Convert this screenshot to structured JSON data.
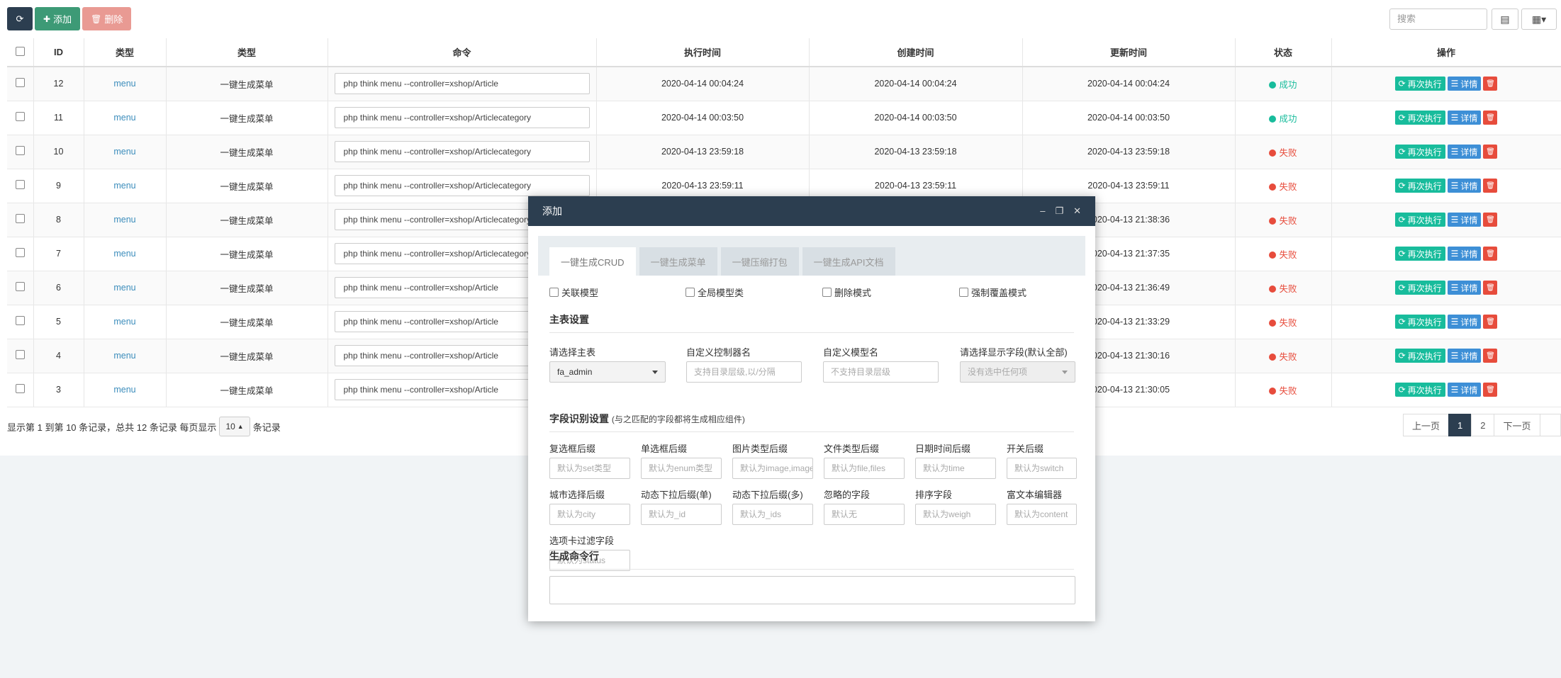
{
  "toolbar": {
    "refresh_icon": "refresh-icon",
    "add_label": "添加",
    "delete_label": "删除",
    "search_placeholder": "搜索"
  },
  "table": {
    "headers": [
      "ID",
      "类型",
      "类型",
      "命令",
      "执行时间",
      "创建时间",
      "更新时间",
      "状态",
      "操作"
    ],
    "rows": [
      {
        "id": "12",
        "type": "menu",
        "type2": "一键生成菜单",
        "cmd": "php think menu --controller=xshop/Article",
        "exec": "2020-04-14 00:04:24",
        "created": "2020-04-14 00:04:24",
        "updated": "2020-04-14 00:04:24",
        "status": "成功"
      },
      {
        "id": "11",
        "type": "menu",
        "type2": "一键生成菜单",
        "cmd": "php think menu --controller=xshop/Articlecategory",
        "exec": "2020-04-14 00:03:50",
        "created": "2020-04-14 00:03:50",
        "updated": "2020-04-14 00:03:50",
        "status": "成功"
      },
      {
        "id": "10",
        "type": "menu",
        "type2": "一键生成菜单",
        "cmd": "php think menu --controller=xshop/Articlecategory",
        "exec": "2020-04-13 23:59:18",
        "created": "2020-04-13 23:59:18",
        "updated": "2020-04-13 23:59:18",
        "status": "失败"
      },
      {
        "id": "9",
        "type": "menu",
        "type2": "一键生成菜单",
        "cmd": "php think menu --controller=xshop/Articlecategory",
        "exec": "2020-04-13 23:59:11",
        "created": "2020-04-13 23:59:11",
        "updated": "2020-04-13 23:59:11",
        "status": "失败"
      },
      {
        "id": "8",
        "type": "menu",
        "type2": "一键生成菜单",
        "cmd": "php think menu --controller=xshop/Articlecategory",
        "exec": "",
        "created": "",
        "updated": "2020-04-13 21:38:36",
        "status": "失败"
      },
      {
        "id": "7",
        "type": "menu",
        "type2": "一键生成菜单",
        "cmd": "php think menu --controller=xshop/Articlecategory",
        "exec": "",
        "created": "",
        "updated": "2020-04-13 21:37:35",
        "status": "失败"
      },
      {
        "id": "6",
        "type": "menu",
        "type2": "一键生成菜单",
        "cmd": "php think menu --controller=xshop/Article",
        "exec": "",
        "created": "",
        "updated": "2020-04-13 21:36:49",
        "status": "失败"
      },
      {
        "id": "5",
        "type": "menu",
        "type2": "一键生成菜单",
        "cmd": "php think menu --controller=xshop/Article",
        "exec": "",
        "created": "",
        "updated": "2020-04-13 21:33:29",
        "status": "失败"
      },
      {
        "id": "4",
        "type": "menu",
        "type2": "一键生成菜单",
        "cmd": "php think menu --controller=xshop/Article",
        "exec": "",
        "created": "",
        "updated": "2020-04-13 21:30:16",
        "status": "失败"
      },
      {
        "id": "3",
        "type": "menu",
        "type2": "一键生成菜单",
        "cmd": "php think menu --controller=xshop/Article",
        "exec": "",
        "created": "",
        "updated": "2020-04-13 21:30:05",
        "status": "失败"
      }
    ],
    "actions": {
      "rerun": "再次执行",
      "detail": "详情"
    }
  },
  "colors": {
    "success": "#18bc9c",
    "fail": "#e74c3c",
    "dark": "#2c3e50"
  },
  "footer": {
    "info_prefix": "显示第 1 到第 10 条记录，总共 12 条记录 每页显示",
    "page_size": "10",
    "info_suffix": "条记录",
    "prev": "上一页",
    "pages": [
      "1",
      "2"
    ],
    "next": "下一页"
  },
  "modal": {
    "title": "添加",
    "tabs": [
      "一键生成CRUD",
      "一键生成菜单",
      "一键压缩打包",
      "一键生成API文档"
    ],
    "checkboxes": [
      "关联模型",
      "全局模型类",
      "删除模式",
      "强制覆盖模式"
    ],
    "main_section": "主表设置",
    "main_fields": {
      "table_label": "请选择主表",
      "table_value": "fa_admin",
      "controller_label": "自定义控制器名",
      "controller_placeholder": "支持目录层级,以/分隔",
      "model_label": "自定义模型名",
      "model_placeholder": "不支持目录层级",
      "fields_label": "请选择显示字段(默认全部)",
      "fields_placeholder": "没有选中任何项"
    },
    "field_section": "字段识别设置",
    "field_section_note": "(与之匹配的字段都将生成相应组件)",
    "suffix_fields": [
      {
        "label": "复选框后缀",
        "placeholder": "默认为set类型"
      },
      {
        "label": "单选框后缀",
        "placeholder": "默认为enum类型"
      },
      {
        "label": "图片类型后缀",
        "placeholder": "默认为image,images"
      },
      {
        "label": "文件类型后缀",
        "placeholder": "默认为file,files"
      },
      {
        "label": "日期时间后缀",
        "placeholder": "默认为time"
      },
      {
        "label": "开关后缀",
        "placeholder": "默认为switch"
      },
      {
        "label": "城市选择后缀",
        "placeholder": "默认为city"
      },
      {
        "label": "动态下拉后缀(单)",
        "placeholder": "默认为_id"
      },
      {
        "label": "动态下拉后缀(多)",
        "placeholder": "默认为_ids"
      },
      {
        "label": "忽略的字段",
        "placeholder": "默认无"
      },
      {
        "label": "排序字段",
        "placeholder": "默认为weigh"
      },
      {
        "label": "富文本编辑器",
        "placeholder": "默认为content"
      },
      {
        "label": "选项卡过滤字段",
        "placeholder": "默认为status"
      }
    ],
    "command_section": "生成命令行"
  }
}
